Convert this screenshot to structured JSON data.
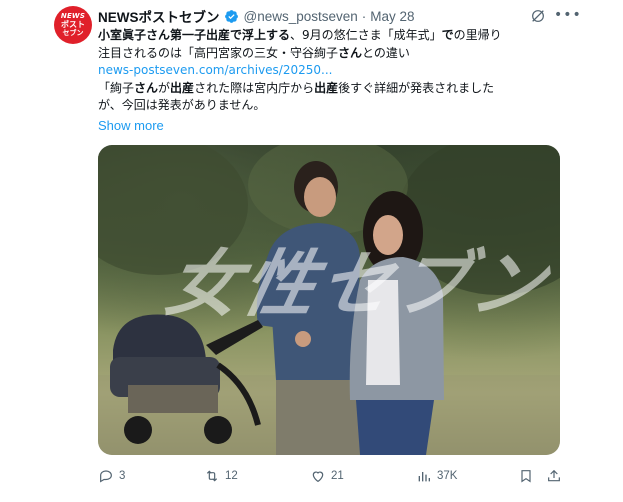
{
  "account": {
    "display_name": "NEWSポストセブン",
    "handle": "@news_postseven",
    "separator": "·",
    "date": "May 28",
    "avatar_text": [
      "NEWS",
      "ポスト",
      "セブン"
    ]
  },
  "tweet": {
    "line1_bold": "小室眞子さん第一子出産で浮上する",
    "line1_rest_a": "、9月の悠仁さま「成年式」",
    "line1_bold2": "で",
    "line1_rest_b": "の里帰り",
    "line2_a": "注目されるのは「高円宮家の三女・守谷絢子",
    "line2_bold": "さん",
    "line2_b": "との違い",
    "link": "news-postseven.com/archives/20250...",
    "line3_a": "「絢子",
    "line3_bold1": "さん",
    "line3_b": "が",
    "line3_bold2": "出産",
    "line3_c": "された際は宮内庁から",
    "line3_bold3": "出産",
    "line3_d": "後すぐ詳細が発表されました",
    "line4": "が、今回は発表がありません。",
    "show_more": "Show more"
  },
  "media": {
    "watermark": "女性セブン"
  },
  "actions": {
    "replies": "3",
    "reposts": "12",
    "likes": "21",
    "views": "37K"
  },
  "colors": {
    "accent": "#1d9bf0",
    "muted": "#536471",
    "avatar_bg": "#e0202a"
  }
}
